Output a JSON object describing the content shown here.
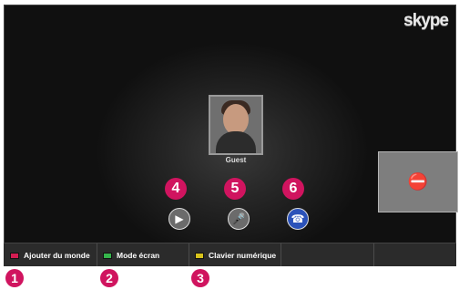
{
  "brand": {
    "logo": "skype"
  },
  "call": {
    "contact_name": "Guest",
    "buttons": {
      "video_icon": "video-camera-icon",
      "mic_icon": "microphone-icon",
      "hangup_icon": "phone-hangup-icon"
    },
    "preview_icon": "video-off-icon"
  },
  "markers": {
    "m1": "1",
    "m2": "2",
    "m3": "3",
    "m4": "4",
    "m5": "5",
    "m6": "6"
  },
  "bottom_bar": {
    "items": [
      {
        "label": "Ajouter du monde",
        "color": "#d31c52"
      },
      {
        "label": "Mode écran",
        "color": "#35b54b"
      },
      {
        "label": "Clavier numérique",
        "color": "#d8c31b"
      }
    ]
  }
}
